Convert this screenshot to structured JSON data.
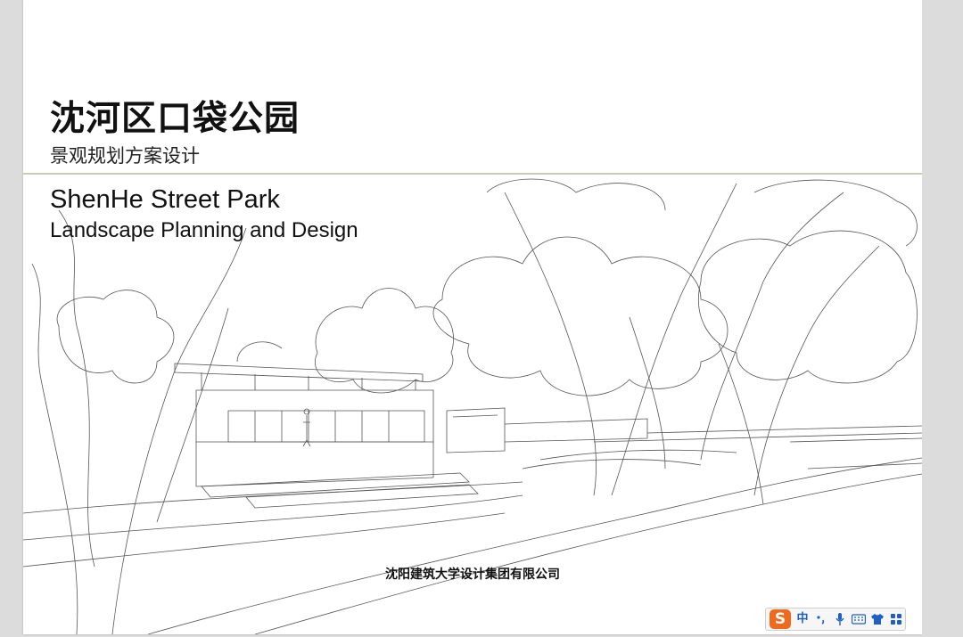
{
  "document": {
    "title_cn": "沈河区口袋公园",
    "subtitle_cn": "景观规划方案设计",
    "title_en": "ShenHe Street Park",
    "subtitle_en": "Landscape Planning and Design",
    "company": "沈阳建筑大学设计集团有限公司"
  },
  "ime_toolbar": {
    "logo": "S",
    "lang": "中",
    "icons": [
      "punctuation-icon",
      "microphone-icon",
      "keyboard-icon",
      "skin-icon",
      "toolbox-icon"
    ],
    "brand_color": "#f06a1d",
    "icon_color": "#1f5fbf"
  },
  "colors": {
    "rule": "#c8cfb4",
    "sketch_line": "#555555"
  }
}
